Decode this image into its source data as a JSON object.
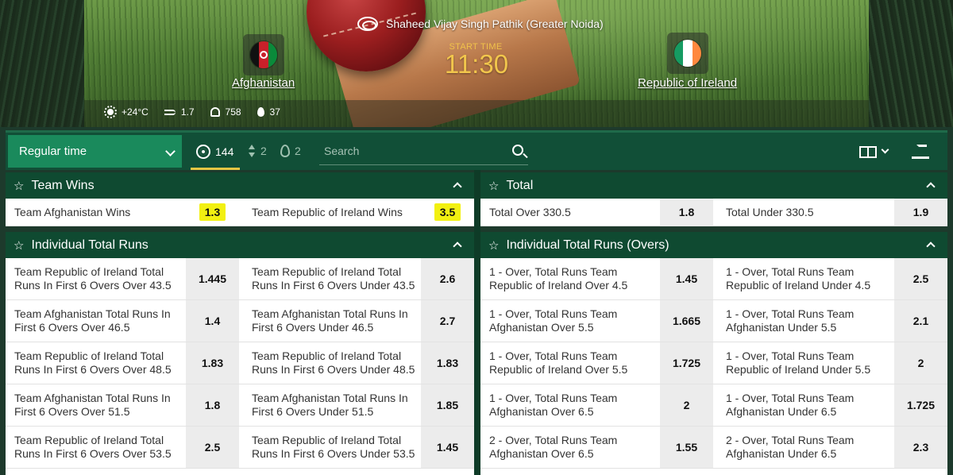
{
  "hero": {
    "venue": "Shaheed Vijay Singh Pathik (Greater Noida)",
    "start_label": "START TIME",
    "start_time": "11:30",
    "team_home": "Afghanistan",
    "team_away": "Republic of Ireland",
    "weather": {
      "temperature": "+24°C",
      "wind": "1.7",
      "pressure": "758",
      "humidity": "37"
    }
  },
  "toolbar": {
    "period": "Regular time",
    "markets_count": "144",
    "updown_count": "2",
    "hot_count": "2",
    "search_placeholder": "Search"
  },
  "team_wins": {
    "title": "Team Wins",
    "rows": [
      [
        {
          "label": "Team Afghanistan Wins",
          "odd": "1.3",
          "highlight": true
        },
        {
          "label": "Team Republic of Ireland Wins",
          "odd": "3.5",
          "highlight": true
        }
      ]
    ]
  },
  "total": {
    "title": "Total",
    "rows": [
      [
        {
          "label": "Total Over 330.5",
          "odd": "1.8"
        },
        {
          "label": "Total Under 330.5",
          "odd": "1.9"
        }
      ]
    ]
  },
  "individual_total_runs": {
    "title": "Individual Total Runs",
    "rows": [
      [
        {
          "label": "Team Republic of Ireland Total Runs In First 6 Overs Over 43.5",
          "odd": "1.445"
        },
        {
          "label": "Team Republic of Ireland Total Runs In First 6 Overs Under 43.5",
          "odd": "2.6"
        }
      ],
      [
        {
          "label": "Team Afghanistan Total Runs In First 6 Overs Over 46.5",
          "odd": "1.4"
        },
        {
          "label": "Team Afghanistan Total Runs In First 6 Overs Under 46.5",
          "odd": "2.7"
        }
      ],
      [
        {
          "label": "Team Republic of Ireland Total Runs In First 6 Overs Over 48.5",
          "odd": "1.83"
        },
        {
          "label": "Team Republic of Ireland Total Runs In First 6 Overs Under 48.5",
          "odd": "1.83"
        }
      ],
      [
        {
          "label": "Team Afghanistan Total Runs In First 6 Overs Over 51.5",
          "odd": "1.8"
        },
        {
          "label": "Team Afghanistan Total Runs In First 6 Overs Under 51.5",
          "odd": "1.85"
        }
      ],
      [
        {
          "label": "Team Republic of Ireland Total Runs In First 6 Overs Over 53.5",
          "odd": "2.5"
        },
        {
          "label": "Team Republic of Ireland Total Runs In First 6 Overs Under 53.5",
          "odd": "1.45"
        }
      ]
    ]
  },
  "individual_total_runs_overs": {
    "title": "Individual Total Runs (Overs)",
    "rows": [
      [
        {
          "label": "1 - Over, Total Runs Team Republic of Ireland Over 4.5",
          "odd": "1.45"
        },
        {
          "label": "1 - Over, Total Runs Team Republic of Ireland Under 4.5",
          "odd": "2.5"
        }
      ],
      [
        {
          "label": "1 - Over, Total Runs Team Afghanistan Over 5.5",
          "odd": "1.665"
        },
        {
          "label": "1 - Over, Total Runs Team Afghanistan Under 5.5",
          "odd": "2.1"
        }
      ],
      [
        {
          "label": "1 - Over, Total Runs Team Republic of Ireland Over 5.5",
          "odd": "1.725"
        },
        {
          "label": "1 - Over, Total Runs Team Republic of Ireland Under 5.5",
          "odd": "2"
        }
      ],
      [
        {
          "label": "1 - Over, Total Runs Team Afghanistan Over 6.5",
          "odd": "2"
        },
        {
          "label": "1 - Over, Total Runs Team Afghanistan Under 6.5",
          "odd": "1.725"
        }
      ],
      [
        {
          "label": "2 - Over, Total Runs Team Afghanistan Over 6.5",
          "odd": "1.55"
        },
        {
          "label": "2 - Over, Total Runs Team Afghanistan Under 6.5",
          "odd": "2.3"
        }
      ]
    ]
  },
  "colors": {
    "header_green": "#0f4a31",
    "toolbar_green": "#114f37",
    "accent_green": "#1a8a5c",
    "highlight_yellow": "#f2f011",
    "start_time_gold": "#f2c64c"
  },
  "icons": [
    "stadium-icon",
    "sun-icon",
    "wind-icon",
    "pressure-icon",
    "humidity-icon",
    "target-icon",
    "updown-icon",
    "fire-icon",
    "search-icon",
    "layout-icon",
    "pin-icon",
    "star-icon",
    "collapse-icon",
    "chevron-down-icon"
  ]
}
